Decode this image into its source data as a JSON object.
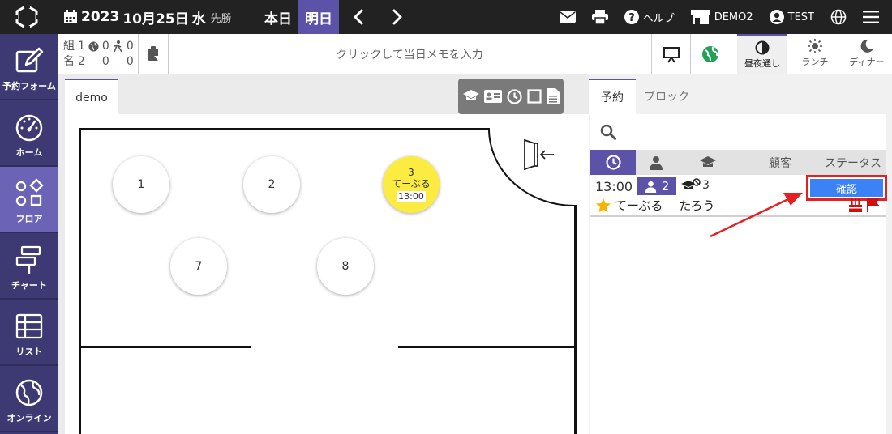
{
  "header": {
    "year": "2023",
    "date": "10月25日",
    "weekday": "水",
    "rokuyo": "先勝",
    "today_label": "本日",
    "tomorrow_label": "明日",
    "help_label": "ヘルプ",
    "shop_label": "DEMO2",
    "user_label": "TEST"
  },
  "sidebar": {
    "items": [
      {
        "label": "予約フォーム",
        "icon": "edit-icon"
      },
      {
        "label": "ホーム",
        "icon": "dashboard-icon"
      },
      {
        "label": "フロア",
        "icon": "floor-icon"
      },
      {
        "label": "チャート",
        "icon": "chart-icon"
      },
      {
        "label": "リスト",
        "icon": "list-icon"
      },
      {
        "label": "オンライン",
        "icon": "globe-icon"
      }
    ]
  },
  "infobar": {
    "groups_label": "組",
    "people_label": "名",
    "groups_total": "1",
    "groups_online": "0",
    "groups_walkin": "0",
    "people_total": "2",
    "people_online": "0",
    "people_walkin": "0",
    "memo_placeholder": "クリックして当日メモを入力",
    "meals": [
      {
        "label": "昼夜通し",
        "active": true
      },
      {
        "label": "ランチ",
        "active": false
      },
      {
        "label": "ディナー",
        "active": false
      }
    ]
  },
  "floor": {
    "tab_label": "demo",
    "tables": [
      {
        "number": "1"
      },
      {
        "number": "2"
      },
      {
        "number": "3",
        "name": "てーぶる",
        "time": "13:00",
        "occupied": true
      },
      {
        "number": "7"
      },
      {
        "number": "8"
      }
    ]
  },
  "panel": {
    "tabs": [
      "予約",
      "ブロック"
    ],
    "columns": {
      "customer": "顧客",
      "status": "ステータス"
    },
    "reservation": {
      "time": "13:00",
      "pax": "2",
      "table": "3",
      "table_name": "てーぶる",
      "customer_name": "たろう",
      "status": "確認"
    }
  },
  "colors": {
    "accent": "#5c52a8",
    "sidebar": "#3d3973",
    "status_button": "#3b82f6",
    "highlight": "#e52020",
    "occupied_table": "#fcec42"
  }
}
